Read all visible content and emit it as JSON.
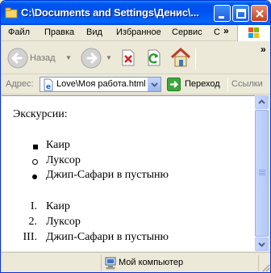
{
  "window": {
    "title": "C:\\Documents and Settings\\Денис\\..."
  },
  "menu": {
    "items": [
      "Файл",
      "Правка",
      "Вид",
      "Избранное",
      "Сервис",
      "С"
    ],
    "more": "»"
  },
  "toolbar": {
    "back_label": "Назад",
    "more": "»"
  },
  "address": {
    "label": "Адрес:",
    "value": "Love\\Моя работа.html",
    "go_label": "Переход",
    "links_label": "Ссылки"
  },
  "page": {
    "heading": "Экскурсии:",
    "unordered_items": [
      "Каир",
      "Луксор",
      "Джип-Сафари в пустыню"
    ],
    "ordered_markers": [
      "I.",
      "2.",
      "III."
    ],
    "ordered_items": [
      "Каир",
      "Луксор",
      "Джип-Сафари в пустыню"
    ]
  },
  "status": {
    "zone": "Мой компьютер"
  },
  "colors": {
    "titlebar": "#0053ee",
    "close_button": "#c3431c",
    "content_bg": "#ffffff",
    "chrome_bg": "#ece9d8"
  }
}
